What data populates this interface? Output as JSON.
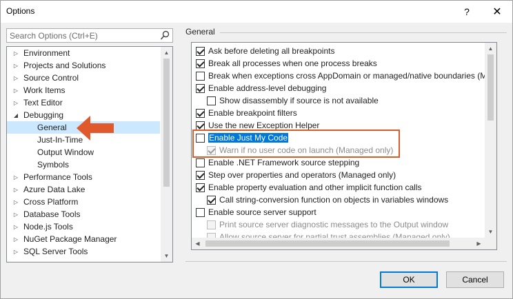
{
  "window": {
    "title": "Options",
    "help_label": "?",
    "close_label": "✕"
  },
  "search": {
    "placeholder": "Search Options (Ctrl+E)"
  },
  "tree": {
    "items": [
      {
        "label": "Environment",
        "arrow": "▷"
      },
      {
        "label": "Projects and Solutions",
        "arrow": "▷"
      },
      {
        "label": "Source Control",
        "arrow": "▷"
      },
      {
        "label": "Work Items",
        "arrow": "▷"
      },
      {
        "label": "Text Editor",
        "arrow": "▷"
      },
      {
        "label": "Debugging",
        "arrow": "◢"
      },
      {
        "label": "General",
        "arrow": ""
      },
      {
        "label": "Just-In-Time",
        "arrow": ""
      },
      {
        "label": "Output Window",
        "arrow": ""
      },
      {
        "label": "Symbols",
        "arrow": ""
      },
      {
        "label": "Performance Tools",
        "arrow": "▷"
      },
      {
        "label": "Azure Data Lake",
        "arrow": "▷"
      },
      {
        "label": "Cross Platform",
        "arrow": "▷"
      },
      {
        "label": "Database Tools",
        "arrow": "▷"
      },
      {
        "label": "Node.js Tools",
        "arrow": "▷"
      },
      {
        "label": "NuGet Package Manager",
        "arrow": "▷"
      },
      {
        "label": "SQL Server Tools",
        "arrow": "▷"
      }
    ],
    "selected_index": 6
  },
  "section": {
    "title": "General"
  },
  "options": [
    {
      "label": "Ask before deleting all breakpoints",
      "checked": true,
      "indent": 0,
      "disabled": false
    },
    {
      "label": "Break all processes when one process breaks",
      "checked": true,
      "indent": 0,
      "disabled": false
    },
    {
      "label": "Break when exceptions cross AppDomain or managed/native boundaries (Ma",
      "checked": false,
      "indent": 0,
      "disabled": false
    },
    {
      "label": "Enable address-level debugging",
      "checked": true,
      "indent": 0,
      "disabled": false
    },
    {
      "label": "Show disassembly if source is not available",
      "checked": false,
      "indent": 1,
      "disabled": false
    },
    {
      "label": "Enable breakpoint filters",
      "checked": true,
      "indent": 0,
      "disabled": false
    },
    {
      "label": "Use the new Exception Helper",
      "checked": true,
      "indent": 0,
      "disabled": false
    },
    {
      "label": "Enable Just My Code",
      "checked": false,
      "indent": 0,
      "disabled": false,
      "highlighted": true
    },
    {
      "label": "Warn if no user code on launch (Managed only)",
      "checked": true,
      "indent": 1,
      "disabled": true
    },
    {
      "label": "Enable .NET Framework source stepping",
      "checked": false,
      "indent": 0,
      "disabled": false
    },
    {
      "label": "Step over properties and operators (Managed only)",
      "checked": true,
      "indent": 0,
      "disabled": false
    },
    {
      "label": "Enable property evaluation and other implicit function calls",
      "checked": true,
      "indent": 0,
      "disabled": false
    },
    {
      "label": "Call string-conversion function on objects in variables windows",
      "checked": true,
      "indent": 1,
      "disabled": false
    },
    {
      "label": "Enable source server support",
      "checked": false,
      "indent": 0,
      "disabled": false
    },
    {
      "label": "Print source server diagnostic messages to the Output window",
      "checked": false,
      "indent": 1,
      "disabled": true
    },
    {
      "label": "Allow source server for partial trust assemblies (Managed only)",
      "checked": false,
      "indent": 1,
      "disabled": true
    }
  ],
  "buttons": {
    "ok": "OK",
    "cancel": "Cancel"
  },
  "colors": {
    "selection": "#cce8ff",
    "highlight_box": "#d85b2a",
    "accent": "#0078d7"
  }
}
